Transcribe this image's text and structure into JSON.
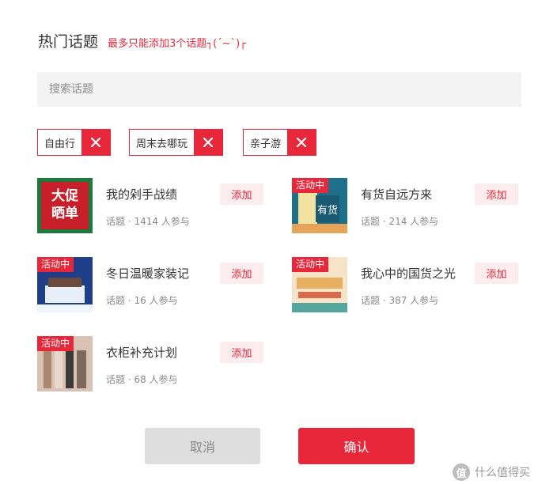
{
  "header": {
    "title": "热门话题",
    "hint": "最多只能添加3个话题┐(´~`)┌"
  },
  "search": {
    "placeholder": "搜索话题"
  },
  "selected_tags": [
    {
      "label": "自由行"
    },
    {
      "label": "周末去哪玩"
    },
    {
      "label": "亲子游"
    }
  ],
  "topics": [
    {
      "name": "我的剁手战绩",
      "meta": "话题 · 1414 人参与",
      "add_label": "添加",
      "thumb_text": [
        "大促",
        "晒单"
      ]
    },
    {
      "name": "有货自远方来",
      "meta": "话题 · 214 人参与",
      "add_label": "添加",
      "badge": "活动中",
      "thumb_text": [
        "有货"
      ]
    },
    {
      "name": "冬日温暖家装记",
      "meta": "话题 · 16 人参与",
      "add_label": "添加",
      "badge": "活动中"
    },
    {
      "name": "我心中的国货之光",
      "meta": "话题 · 387 人参与",
      "add_label": "添加",
      "badge": "活动中"
    },
    {
      "name": "衣柜补充计划",
      "meta": "话题 · 68 人参与",
      "add_label": "添加",
      "badge": "活动中"
    }
  ],
  "buttons": {
    "cancel": "取消",
    "confirm": "确认"
  },
  "watermark": {
    "icon": "值",
    "text": "什么值得买"
  },
  "colors": {
    "accent": "#e8283a",
    "add_bg": "#fdecee",
    "cancel_bg": "#dedede",
    "search_bg": "#f3f3f3"
  }
}
